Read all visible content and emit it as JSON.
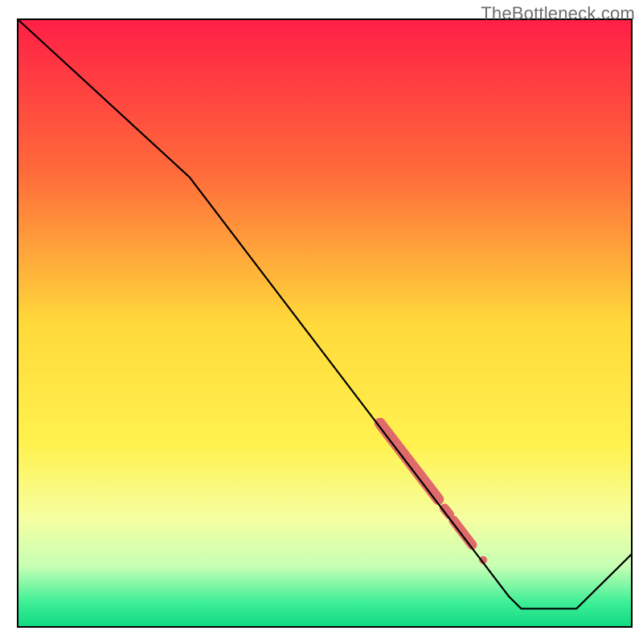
{
  "watermark": "TheBottleneck.com",
  "chart_data": {
    "type": "line",
    "title": "",
    "xlabel": "",
    "ylabel": "",
    "xlim": [
      0,
      100
    ],
    "ylim": [
      0,
      100
    ],
    "background_gradient": {
      "stops": [
        {
          "offset": 0.0,
          "color": "#ff1f46"
        },
        {
          "offset": 0.25,
          "color": "#ff6a3a"
        },
        {
          "offset": 0.5,
          "color": "#ffd93a"
        },
        {
          "offset": 0.7,
          "color": "#fff24f"
        },
        {
          "offset": 0.82,
          "color": "#f6ffa0"
        },
        {
          "offset": 0.9,
          "color": "#c7ffb4"
        },
        {
          "offset": 0.96,
          "color": "#3def97"
        },
        {
          "offset": 1.0,
          "color": "#10d982"
        }
      ]
    },
    "series": [
      {
        "name": "bottleneck-curve",
        "x": [
          0,
          28,
          80,
          82,
          91,
          100
        ],
        "y": [
          100,
          74,
          5,
          3,
          3,
          12
        ],
        "stroke": "#000000",
        "stroke_width": 2.2
      }
    ],
    "highlight_band": {
      "note": "thick salmon segment and dots overlaid on the main line",
      "color": "#e06a6a",
      "segments": [
        {
          "x0": 59,
          "y0": 33.5,
          "x1": 68.5,
          "y1": 21,
          "width": 14
        },
        {
          "x0": 69.5,
          "y0": 19.5,
          "x1": 70.3,
          "y1": 18.5,
          "width": 12
        },
        {
          "x0": 71,
          "y0": 17.5,
          "x1": 74,
          "y1": 13.5,
          "width": 12
        }
      ],
      "dots": [
        {
          "x": 75.8,
          "y": 11,
          "r": 5
        }
      ]
    },
    "plot_border": "#000000"
  }
}
